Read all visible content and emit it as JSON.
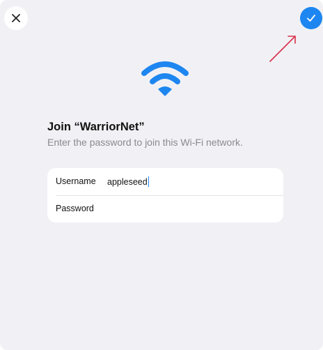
{
  "dialog": {
    "close_icon": "close-icon",
    "confirm_icon": "checkmark-icon",
    "wifi_icon": "wifi-icon",
    "title": "Join “WarriorNet”",
    "subtitle": "Enter the password to join this Wi-Fi network."
  },
  "form": {
    "username_label": "Username",
    "username_value": "appleseed",
    "password_label": "Password",
    "password_value": ""
  },
  "colors": {
    "accent": "#1e86f0",
    "annotation_arrow": "#d8304a",
    "sheet_background": "#f1f1f5"
  }
}
